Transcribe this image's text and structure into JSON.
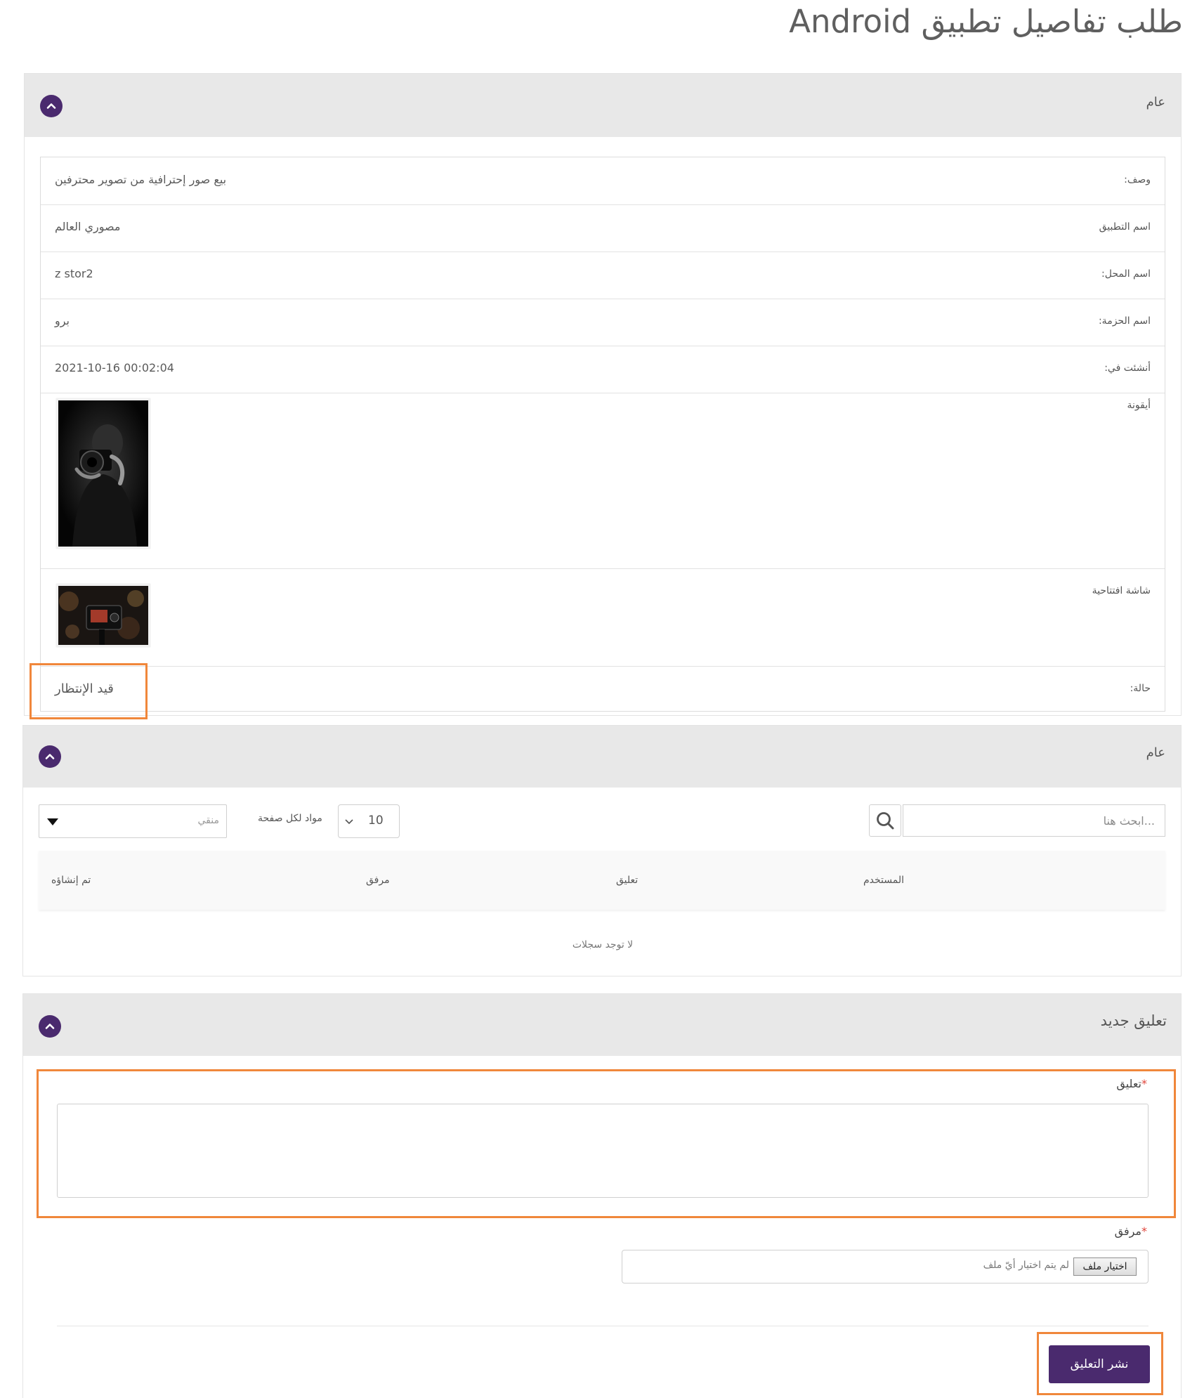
{
  "page": {
    "title": "طلب تفاصيل تطبيق Android"
  },
  "general_section": {
    "title": "عام",
    "rows": [
      {
        "label": "وصف:",
        "value": "بيع صور إحترافية من تصوير محترفين"
      },
      {
        "label": "اسم التطبيق",
        "value": "مصوري العالم"
      },
      {
        "label": "اسم المحل:",
        "value": "z stor2"
      },
      {
        "label": "اسم الحزمة:",
        "value": "برو"
      },
      {
        "label": "أنشئت في:",
        "value": "2021-10-16 00:02:04"
      },
      {
        "label": "أيقونة",
        "image": "icon-photo"
      },
      {
        "label": "شاشة افتتاحية",
        "image": "splash-photo"
      },
      {
        "label": "حالة:",
        "value": "قيد الإنتظار"
      }
    ]
  },
  "records_section": {
    "title": "عام",
    "search_placeholder": "...ابحث هنا",
    "per_page_label": "مواد لكل صفحة",
    "per_page_value": "10",
    "filter_placeholder": "منقي",
    "columns": [
      "المستخدم",
      "تعليق",
      "مرفق",
      "تم إنشاؤه"
    ],
    "empty_message": "لا توجد سجلات"
  },
  "new_comment_section": {
    "title": "تعليق جديد",
    "comment_label": "تعليق",
    "attachment_label": "مرفق",
    "required_mark": "*",
    "choose_file_label": "اختيار ملف",
    "no_file_text": "لم يتم اختيار أيّ ملف",
    "submit_label": "نشر التعليق"
  },
  "colors": {
    "accent": "#4a2a6e",
    "highlight": "#f0873b",
    "header_bg": "#e8e8e8"
  },
  "icons": [
    "chevron-up-icon",
    "search-icon",
    "chevron-down-icon",
    "caret-down-icon"
  ]
}
